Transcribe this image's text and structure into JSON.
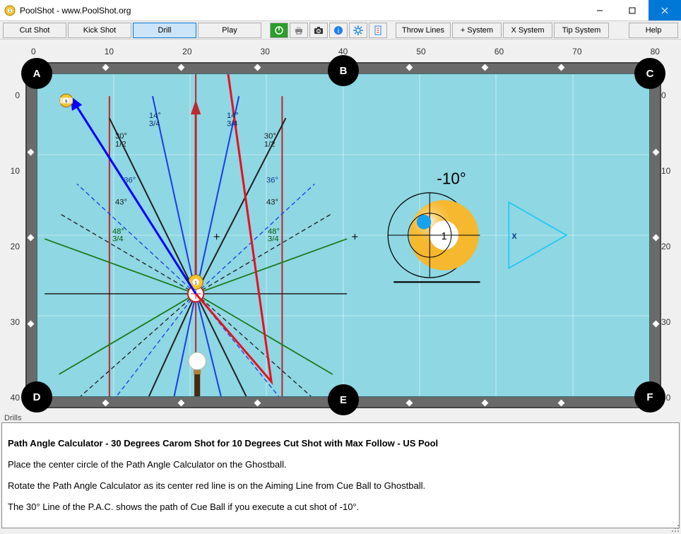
{
  "titlebar": {
    "title": "PoolShot - www.PoolShot.org"
  },
  "toolbar": {
    "cut_shot": "Cut Shot",
    "kick_shot": "Kick Shot",
    "drill": "Drill",
    "play": "Play",
    "throw_lines": "Throw Lines",
    "plus_system": "+ System",
    "x_system": "X System",
    "tip_system": "Tip System",
    "help": "Help"
  },
  "axes": {
    "x": [
      "0",
      "10",
      "20",
      "30",
      "40",
      "50",
      "60",
      "70",
      "80"
    ],
    "y": [
      "0",
      "10",
      "20",
      "30",
      "40"
    ]
  },
  "pockets": {
    "A": "A",
    "B": "B",
    "C": "C",
    "D": "D",
    "E": "E",
    "F": "F"
  },
  "pac": {
    "labels": {
      "l14": "14°\n3/4",
      "r14": "14°\n3/4",
      "l30": "30°\n1/2",
      "r30": "30°\n1/2",
      "l36": "36°",
      "r36": "36°",
      "l43": "43°",
      "r43": "43°",
      "l48": "48°\n3/4",
      "r48": "48°\n3/4"
    },
    "center_plus": "+"
  },
  "aim": {
    "angle_label": "-10°",
    "tip_mark": "x"
  },
  "panel": {
    "tab": "Drills",
    "heading": "Path Angle Calculator - 30 Degrees Carom Shot for 10 Degrees Cut Shot with Max Follow - US Pool",
    "line1": "Place the center circle of the Path Angle Calculator on the Ghostball.",
    "line2": "Rotate the Path Angle Calculator as its center red line is on the Aiming Line from Cue Ball to Ghostball.",
    "line3": "The 30° Line of the P.A.C. shows the path of Cue Ball if you execute a cut shot of -10°."
  }
}
